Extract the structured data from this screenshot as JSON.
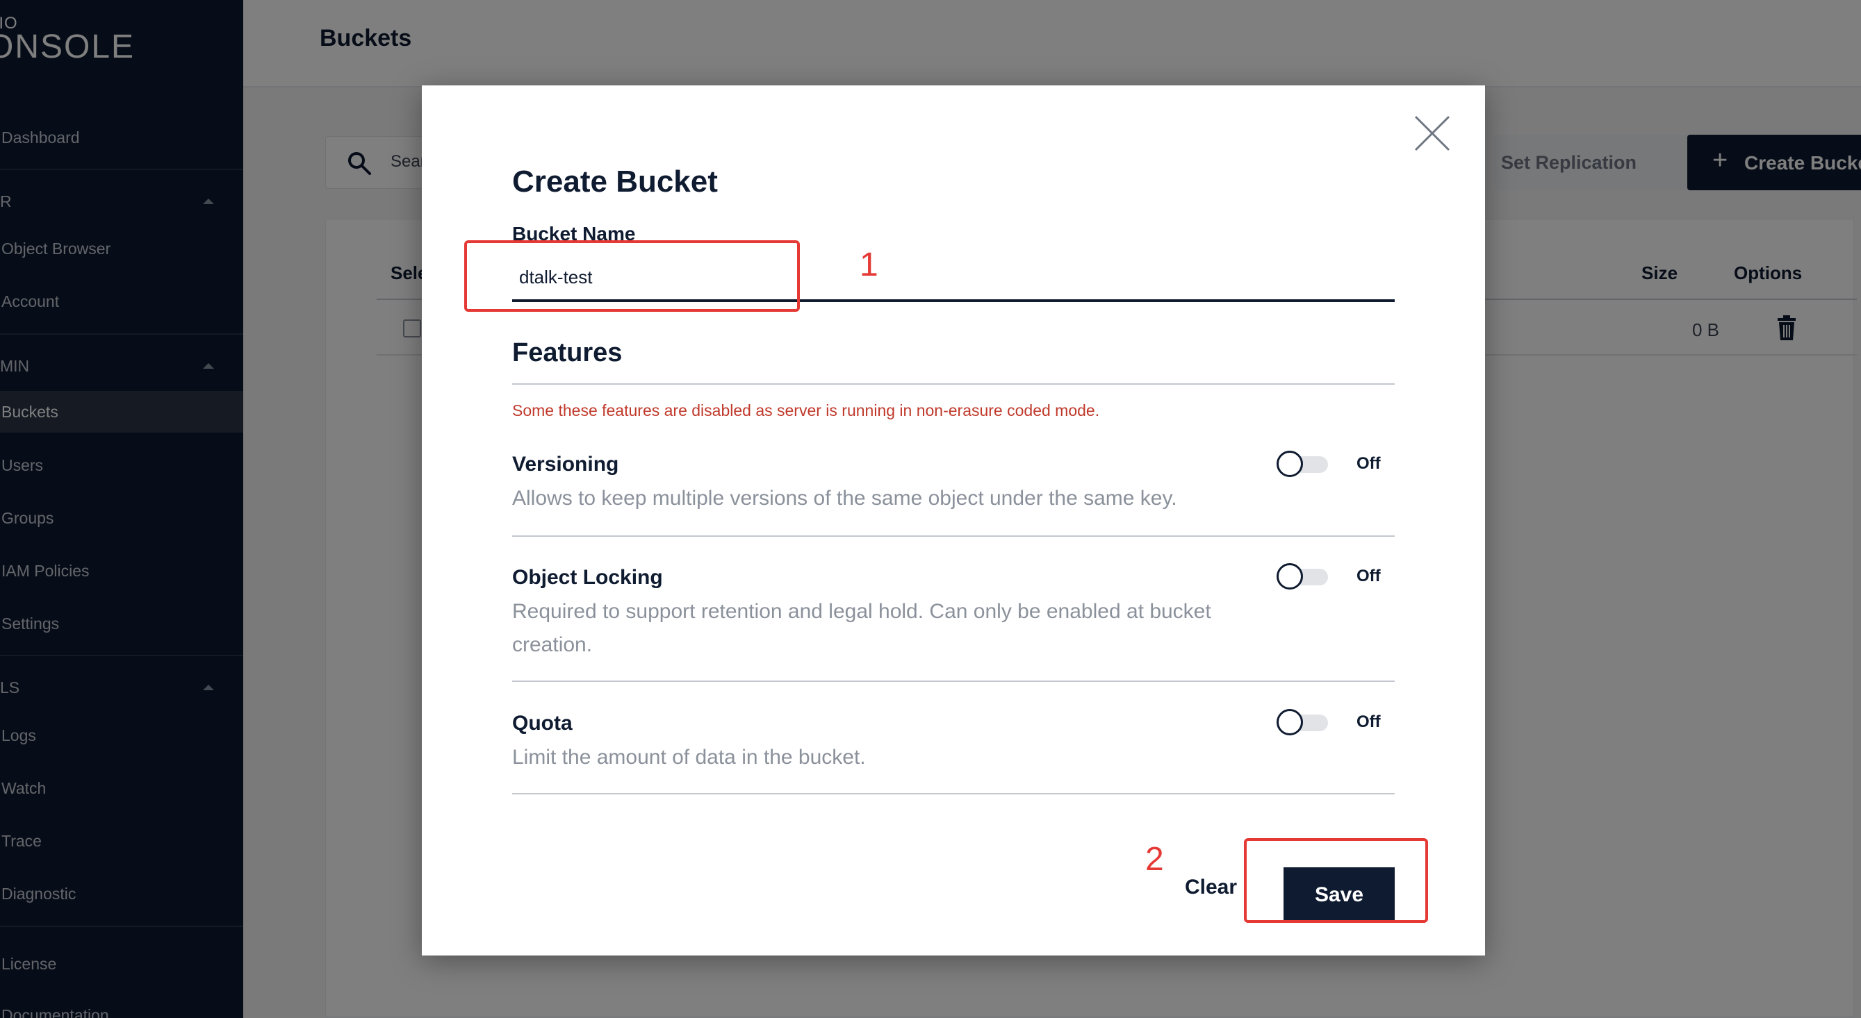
{
  "sidebar": {
    "logo_small": "NIO",
    "logo_big": "ONSOLE",
    "items": [
      {
        "label": "Dashboard"
      },
      {
        "label": "R"
      },
      {
        "label": "Object Browser"
      },
      {
        "label": "Account"
      },
      {
        "label": "MIN"
      },
      {
        "label": "Buckets"
      },
      {
        "label": "Users"
      },
      {
        "label": "Groups"
      },
      {
        "label": "IAM Policies"
      },
      {
        "label": "Settings"
      },
      {
        "label": "LS"
      },
      {
        "label": "Logs"
      },
      {
        "label": "Watch"
      },
      {
        "label": "Trace"
      },
      {
        "label": "Diagnostic"
      },
      {
        "label": "License"
      },
      {
        "label": "Documentation"
      }
    ]
  },
  "page": {
    "title": "Buckets",
    "search_placeholder": "Sear",
    "set_replication_label": "Set Replication",
    "create_bucket_label": "Create Bucke",
    "table": {
      "headers": [
        "Sele",
        "Size",
        "Options"
      ],
      "rows": [
        {
          "size": "0 B"
        }
      ]
    }
  },
  "modal": {
    "title": "Create Bucket",
    "bucket_name_label": "Bucket Name",
    "bucket_name_value": "dtalk-test",
    "features_title": "Features",
    "features_warning": "Some these features are disabled as server is running in non-erasure coded mode.",
    "features": [
      {
        "name": "Versioning",
        "description": "Allows to keep multiple versions of the same object under the same key.",
        "state": "Off"
      },
      {
        "name": "Object Locking",
        "description": "Required to support retention and legal hold. Can only be enabled at bucket creation.",
        "state": "Off"
      },
      {
        "name": "Quota",
        "description": "Limit the amount of data in the bucket.",
        "state": "Off"
      }
    ],
    "clear_label": "Clear",
    "save_label": "Save"
  },
  "annotations": [
    {
      "label": "1"
    },
    {
      "label": "2"
    }
  ],
  "colors": {
    "primary": "#0f1b30",
    "annotation": "#e53935",
    "warning": "#c0392b"
  }
}
